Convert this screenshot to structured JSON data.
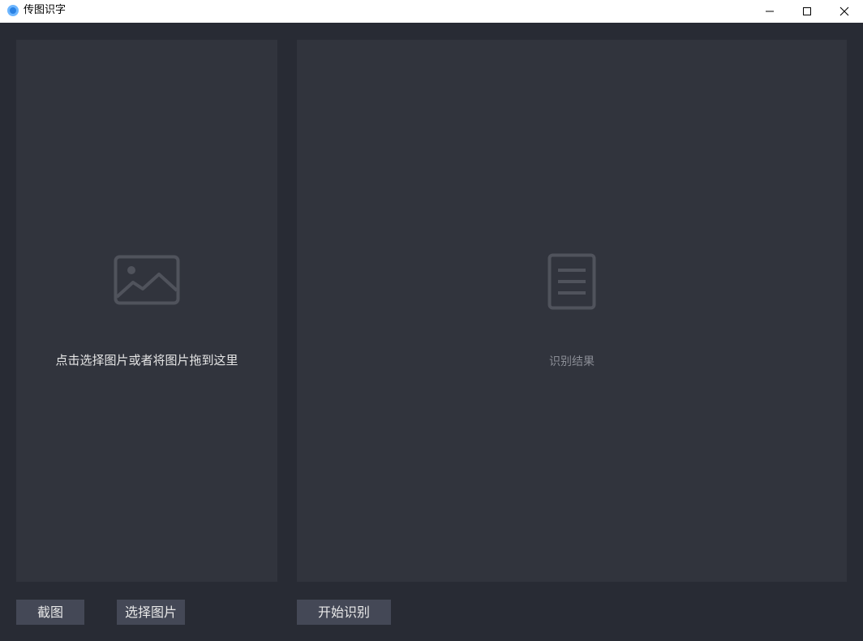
{
  "window": {
    "title": "传图识字",
    "controls": {
      "minimize_icon": "minimize-icon",
      "maximize_icon": "maximize-icon",
      "close_icon": "close-icon"
    }
  },
  "left_panel": {
    "icon": "image-icon",
    "hint": "点击选择图片或者将图片拖到这里"
  },
  "right_panel": {
    "icon": "document-icon",
    "placeholder": "识别结果"
  },
  "buttons": {
    "capture_label": "截图",
    "select_label": "选择图片",
    "start_label": "开始识别"
  },
  "colors": {
    "background": "#282b34",
    "panel": "#31343d",
    "button": "#444856",
    "icon": "#50535c",
    "accent": "#2a82e4"
  }
}
